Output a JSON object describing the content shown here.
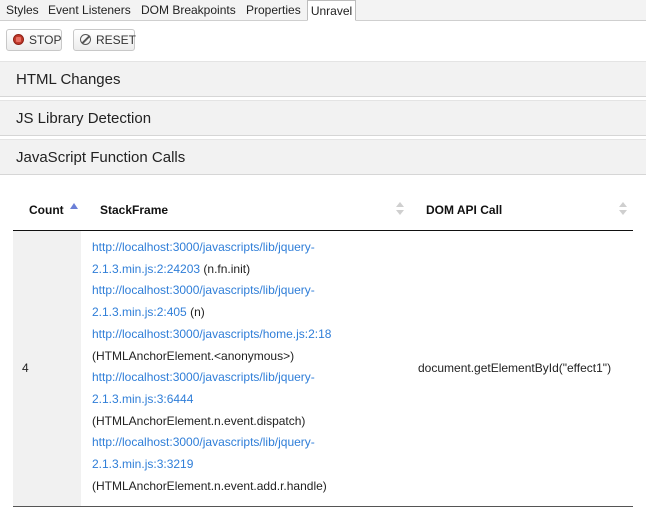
{
  "tabs": [
    "Styles",
    "Event Listeners",
    "DOM Breakpoints",
    "Properties",
    "Unravel"
  ],
  "toolbar": {
    "stop_label": "STOP",
    "reset_label": "RESET"
  },
  "sections": [
    "HTML Changes",
    "JS Library Detection",
    "JavaScript Function Calls"
  ],
  "table": {
    "columns": [
      "Count",
      "StackFrame",
      "DOM API Call"
    ],
    "sort": {
      "column": "Count",
      "direction": "ascending"
    },
    "rows": [
      {
        "count": "4",
        "stack_lines": [
          {
            "link": "http://localhost:3000/javascripts/lib/jquery-",
            "tail": ""
          },
          {
            "link": "2.1.3.min.js:2:24203",
            "tail": " (n.fn.init)"
          },
          {
            "link": "http://localhost:3000/javascripts/lib/jquery-",
            "tail": ""
          },
          {
            "link": "2.1.3.min.js:2:405",
            "tail": " (n)"
          },
          {
            "link": "http://localhost:3000/javascripts/home.js:2:18",
            "tail": ""
          },
          {
            "link": "",
            "tail": "(HTMLAnchorElement.<anonymous>)"
          },
          {
            "link": "http://localhost:3000/javascripts/lib/jquery-",
            "tail": ""
          },
          {
            "link": "2.1.3.min.js:3:6444",
            "tail": ""
          },
          {
            "link": "",
            "tail": "(HTMLAnchorElement.n.event.dispatch)"
          },
          {
            "link": "http://localhost:3000/javascripts/lib/jquery-",
            "tail": ""
          },
          {
            "link": "2.1.3.min.js:3:3219",
            "tail": ""
          },
          {
            "link": "",
            "tail": "(HTMLAnchorElement.n.event.add.r.handle)"
          }
        ],
        "dom_call": "document.getElementById(\"effect1\")"
      }
    ]
  },
  "colors": {
    "link": "#2f7ed8",
    "stop_icon": "#c0392b",
    "sort_active": "#6b7fd7"
  }
}
